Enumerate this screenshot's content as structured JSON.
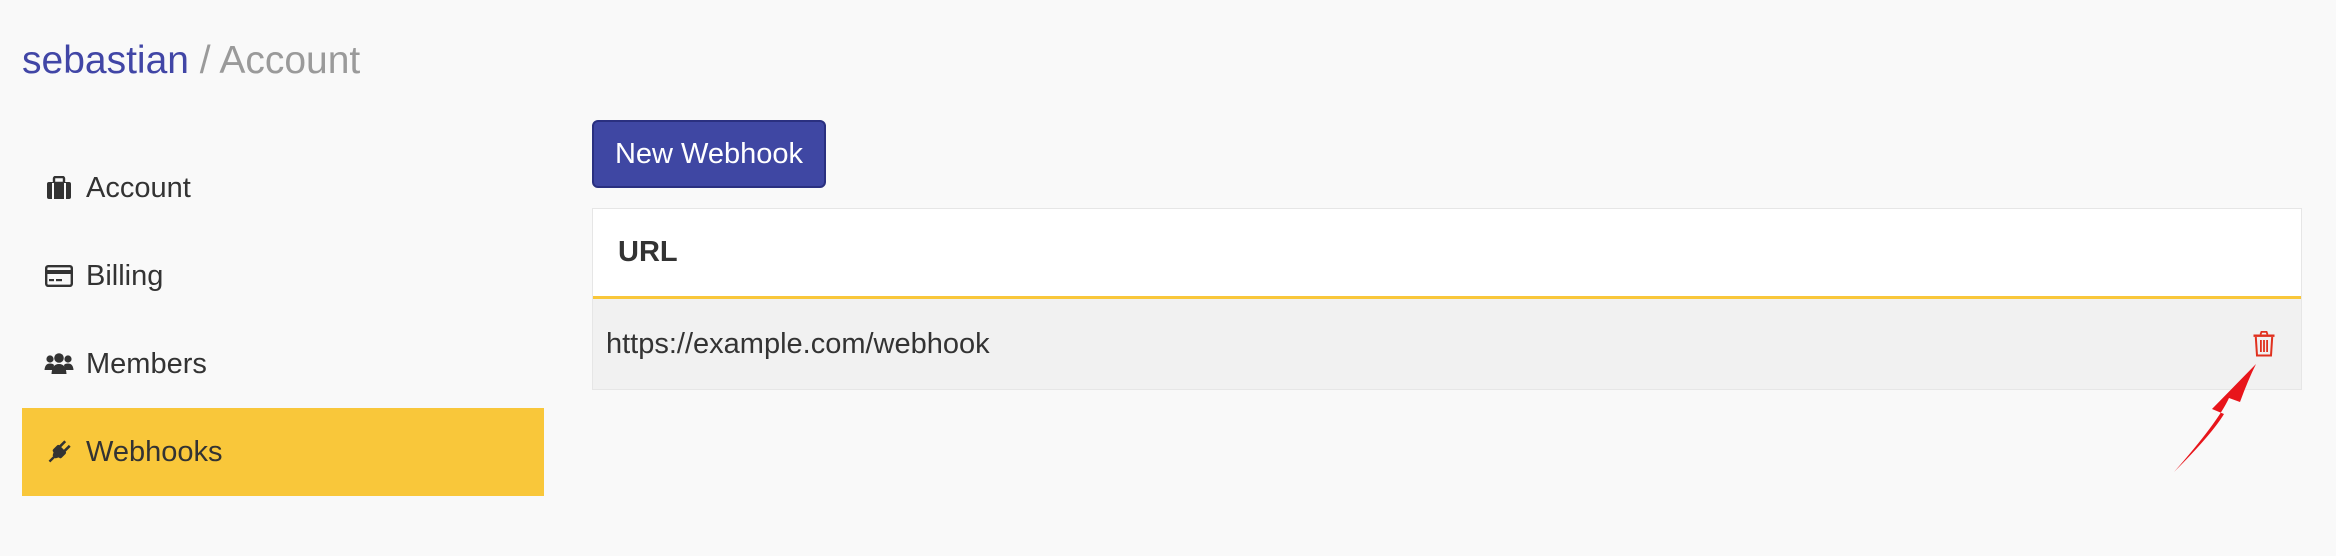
{
  "breadcrumb": {
    "user": "sebastian",
    "separator": " / ",
    "page": "Account"
  },
  "sidebar": {
    "items": [
      {
        "label": "Account",
        "icon": "briefcase-icon"
      },
      {
        "label": "Billing",
        "icon": "credit-card-icon"
      },
      {
        "label": "Members",
        "icon": "users-icon"
      },
      {
        "label": "Webhooks",
        "icon": "plug-icon",
        "active": true
      }
    ]
  },
  "actions": {
    "new_webhook_label": "New Webhook"
  },
  "table": {
    "header_url": "URL",
    "rows": [
      {
        "url": "https://example.com/webhook",
        "action_icon": "trash-icon"
      }
    ]
  },
  "colors": {
    "accent": "#f9c73a",
    "primary_button": "#3f47a3",
    "breadcrumb_user": "#4146a6",
    "delete": "#e0301e",
    "annotation_arrow": "#e8151b"
  }
}
